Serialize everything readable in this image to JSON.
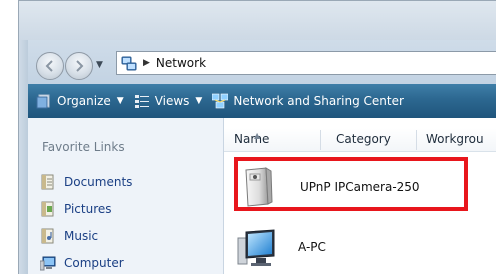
{
  "address_bar": {
    "location": "Network"
  },
  "toolbar": {
    "organize": "Organize",
    "views": "Views",
    "network_center": "Network and Sharing Center"
  },
  "sidebar": {
    "title": "Favorite Links",
    "items": [
      {
        "label": "Documents",
        "icon": "documents-icon"
      },
      {
        "label": "Pictures",
        "icon": "pictures-icon"
      },
      {
        "label": "Music",
        "icon": "music-icon"
      },
      {
        "label": "Computer",
        "icon": "computer-icon"
      }
    ]
  },
  "columns": {
    "name": "Name",
    "category": "Category",
    "workgroup": "Workgrou"
  },
  "items": [
    {
      "label": "UPnP IPCamera-250",
      "icon": "ip-camera-icon"
    },
    {
      "label": "A-PC",
      "icon": "pc-icon"
    }
  ],
  "colors": {
    "toolbar": "#2c6790",
    "highlight": "#e8161c",
    "link_text": "#1a3f84"
  }
}
